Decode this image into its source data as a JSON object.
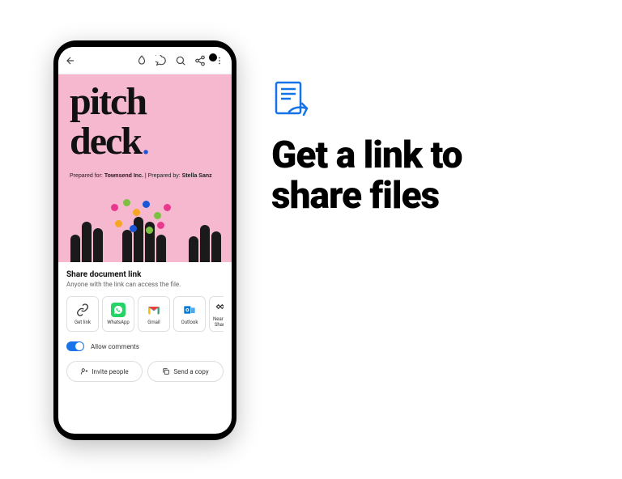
{
  "marketing": {
    "headline_line1": "Get a link to",
    "headline_line2": "share files"
  },
  "document": {
    "title_line1": "pitch",
    "title_line2": "deck",
    "dot": ".",
    "prepared_for_label": "Prepared for: ",
    "prepared_for_value": "Townsend Inc.",
    "separator": " | ",
    "prepared_by_label": "Prepared by: ",
    "prepared_by_value": "Stella Sanz"
  },
  "share": {
    "title": "Share document link",
    "subtitle": "Anyone with the link can access the file.",
    "options": [
      {
        "label": "Get link"
      },
      {
        "label": "WhatsApp"
      },
      {
        "label": "Gmail"
      },
      {
        "label": "Outlook"
      },
      {
        "label": "Nearby Share"
      }
    ],
    "allow_comments_label": "Allow comments",
    "invite_label": "Invite people",
    "send_copy_label": "Send a copy"
  }
}
